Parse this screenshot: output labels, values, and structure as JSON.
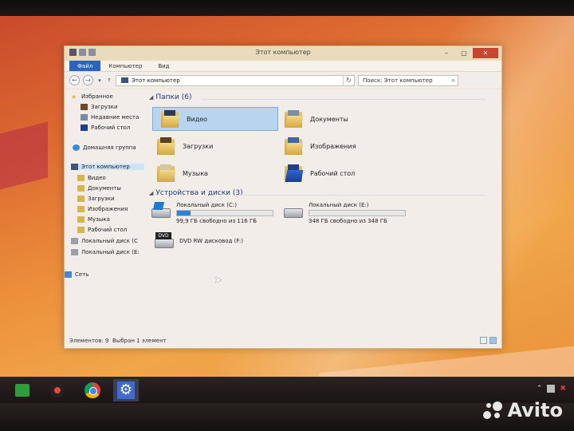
{
  "window": {
    "title": "Этот компьютер",
    "controls": {
      "minimize": "–",
      "maximize": "▢",
      "close": "✕"
    }
  },
  "ribbon": {
    "tabs": [
      "Файл",
      "Компьютер",
      "Вид"
    ]
  },
  "address": {
    "path": "Этот компьютер",
    "search_placeholder": "Поиск: Этот компьютер",
    "back": "←",
    "forward": "→",
    "recent": "▾",
    "up": "↑",
    "refresh": "↻",
    "search_icon": "⌕"
  },
  "nav_pane": {
    "favorites": "Избранное",
    "favorites_items": [
      "Загрузки",
      "Недавние места",
      "Рабочий стол"
    ],
    "homegroup": "Домашняя группа",
    "this_pc": "Этот компьютер",
    "pc_items": [
      "Видео",
      "Документы",
      "Загрузки",
      "Изображения",
      "Музыка",
      "Рабочий стол",
      "Локальный диск (C",
      "Локальный диск (E:"
    ],
    "network": "Сеть"
  },
  "content": {
    "folders_group": "Папки (6)",
    "folders": [
      "Видео",
      "Документы",
      "Загрузки",
      "Изображения",
      "Музыка",
      "Рабочий стол"
    ],
    "devices_group": "Устройства и диски (3)",
    "drives": [
      {
        "name": "Локальный диск (C:)",
        "info": "99,9 ГБ свободно из 116 ГБ",
        "used_fraction": 0.14
      },
      {
        "name": "Локальный диск (E:)",
        "info": "348 ГБ свободно из 348 ГБ",
        "used_fraction": 0.0
      },
      {
        "name": "DVD RW дисковод (F:)",
        "info": ""
      }
    ],
    "dvd_label": "DVD"
  },
  "status": {
    "count": "Элементов: 9",
    "selected": "Выбран 1 элемент"
  },
  "watermark": {
    "text": "Avito"
  },
  "colors": {
    "accent": "#2a64c0",
    "selection": "#b8d5f0",
    "group_title": "#1e3b8a",
    "drive_bar": "#2f83d7"
  }
}
